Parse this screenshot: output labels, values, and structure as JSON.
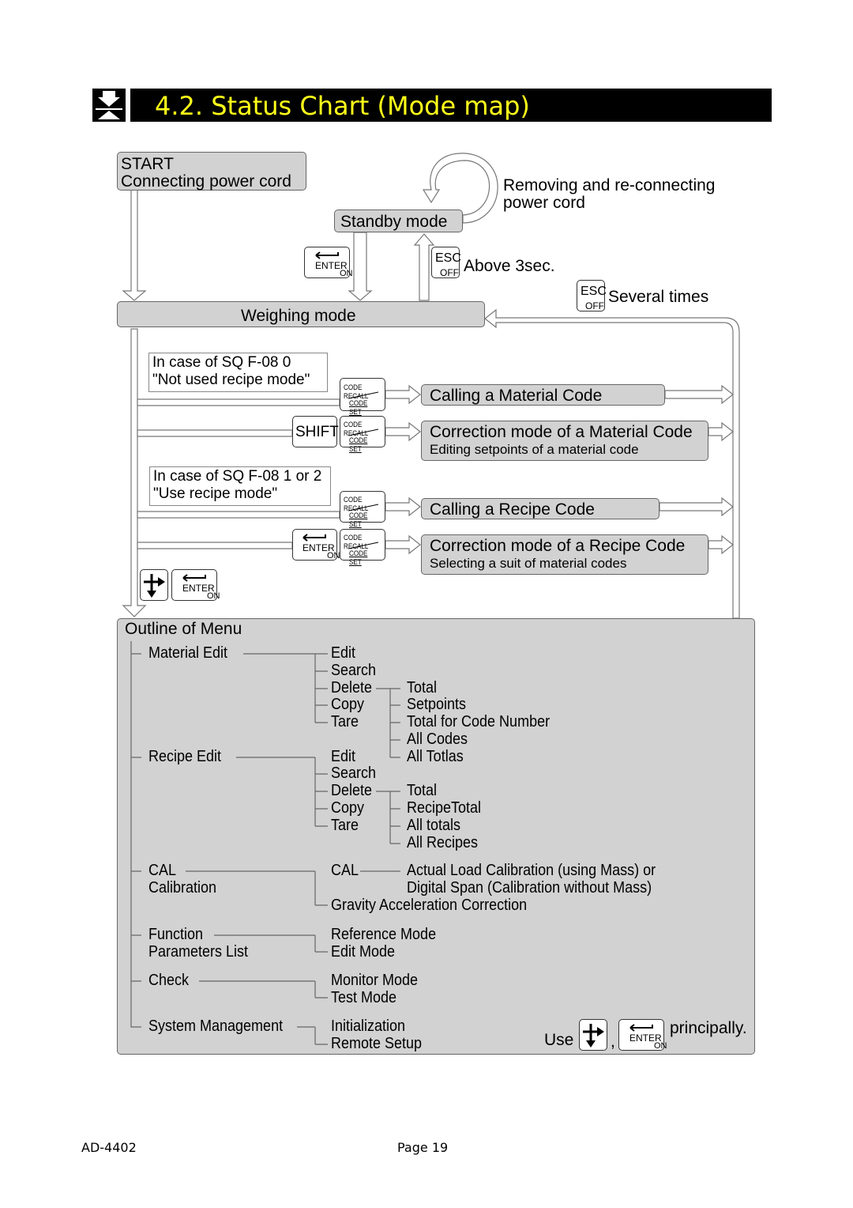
{
  "header": {
    "title": "4.2. Status Chart (Mode map)",
    "icon": "down-up-arrow-icon"
  },
  "flow": {
    "start_line1": "START",
    "start_line2": "Connecting power cord",
    "standby": "Standby mode",
    "reconnect_line1": "Removing and re-connecting",
    "reconnect_line2": "power cord",
    "above_3sec": "Above 3sec.",
    "several_times": "Several times",
    "weighing": "Weighing mode",
    "note_sq0_line1": "In case of SQ F-08 0",
    "note_sq0_line2": "\"Not used recipe mode\"",
    "note_sq12_line1": "In case of SQ F-08 1 or 2",
    "note_sq12_line2": "\"Use recipe mode\"",
    "calling_material": "Calling a Material Code",
    "correction_material": "Correction mode of a Material Code",
    "correction_material_sub": "Editing setpoints of a material code",
    "calling_recipe": "Calling a Recipe Code",
    "correction_recipe": "Correction mode of a Recipe Code",
    "correction_recipe_sub": "Selecting a suit of material codes"
  },
  "keys": {
    "enter": "ENTER",
    "on": "ON",
    "esc": "ESC",
    "off": "OFF",
    "shift": "SHIFT",
    "code_recall": "CODE RECALL",
    "code_set": "CODE SET"
  },
  "menu": {
    "title": "Outline of Menu",
    "material_edit": {
      "label": "Material Edit",
      "items": [
        "Edit",
        "Search",
        "Delete",
        "Copy",
        "Tare"
      ],
      "delete_items": [
        "Total",
        "Setpoints",
        "Total for Code Number",
        "All Codes",
        "All Totlas"
      ]
    },
    "recipe_edit": {
      "label": "Recipe Edit",
      "items": [
        "Edit",
        "Search",
        "Delete",
        "Copy",
        "Tare"
      ],
      "delete_items": [
        "Total",
        "RecipeTotal",
        "All totals",
        "All Recipes"
      ]
    },
    "cal": {
      "label1": "CAL",
      "label2": "Calibration",
      "items": [
        "CAL",
        "Gravity Acceleration Correction"
      ],
      "cal_desc1": "Actual Load Calibration (using Mass) or",
      "cal_desc2": "Digital Span (Calibration without Mass)"
    },
    "function": {
      "label1": "Function",
      "label2": "Parameters List",
      "items": [
        "Reference Mode",
        "Edit Mode"
      ]
    },
    "check": {
      "label": "Check",
      "items": [
        "Monitor Mode",
        "Test Mode"
      ]
    },
    "system": {
      "label": "System Management",
      "items": [
        "Initialization",
        "Remote Setup"
      ]
    },
    "use_prefix": "Use",
    "use_comma": ",",
    "use_suffix": "principally."
  },
  "footer": {
    "model": "AD-4402",
    "page": "Page 19"
  }
}
